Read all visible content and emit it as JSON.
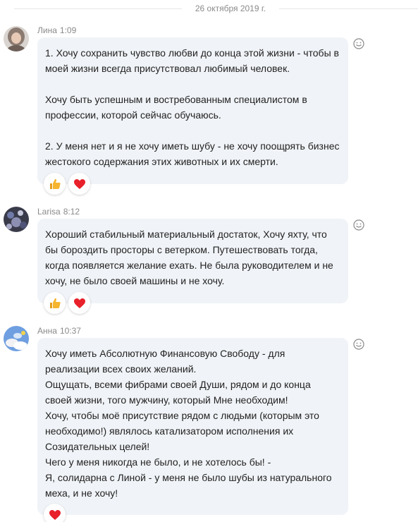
{
  "date_separator": "26 октября 2019 г.",
  "messages": [
    {
      "author": "Лина",
      "time": "1:09",
      "text": "1. Хочу сохранить чувство любви до конца этой жизни - чтобы в моей жизни всегда присутствовал любимый человек.\n\nХочу быть успешным и востребованным специалистом в профессии, которой сейчас обучаюсь.\n\n2. У меня нет и я не хочу иметь шубу - не хочу поощрять бизнес жестокого содержания этих животных и их смерти.",
      "reactions": [
        "thumbs-up",
        "heart"
      ]
    },
    {
      "author": "Larisa",
      "time": "8:12",
      "text": "Хороший стабильный материальный достаток, Хочу яхту, что бы бороздить просторы с ветерком. Путешествовать тогда, когда появляется желание ехать. Не была  руководителем и не хочу, не было своей машины и не хочу.",
      "reactions": [
        "thumbs-up",
        "heart"
      ]
    },
    {
      "author": "Анна",
      "time": "10:37",
      "text": "Хочу иметь Абсолютную Финансовую Свободу - для реализации всех своих желаний.\nОщущать, всеми фибрами своей Души, рядом и до конца своей жизни, того мужчину, который Мне необходим!\n Хочу, чтобы моё присутствие рядом с людьми (которым это необходимо!) являлось катализатором исполнения их Созидательных целей!\nЧего у меня никогда не было, и не хотелось бы!  -\nЯ,  солидарна с Линой - у меня не было шубы из натурального меха, и не хочу!",
      "reactions": [
        "heart"
      ]
    }
  ],
  "colors": {
    "bubble": "#f0f3f7",
    "meta_text": "#8a8a8a",
    "heart": "#e8202a",
    "thumb": "#f5b52e"
  }
}
